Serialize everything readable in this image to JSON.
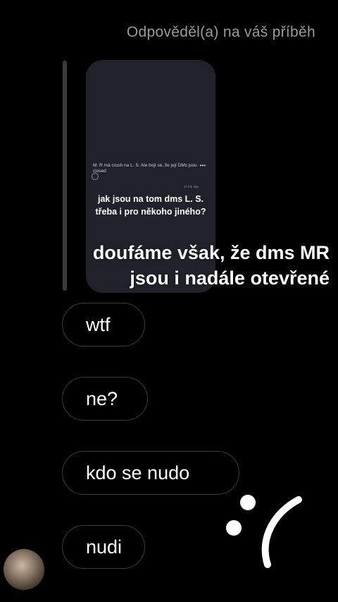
{
  "header": {
    "reply_label": "Odpověděl(a) na váš příběh"
  },
  "story": {
    "tweet_text": "M. R má crush na L. S. Ale bojí se, že její DMs jsou closed",
    "tweet_dots": "•••",
    "tweet_meta": "ch frie nge",
    "overlay_line1": "jak jsou na tom dms L. S.",
    "overlay_line2": "třeba i pro někoho jiného?"
  },
  "caption": {
    "line1": "doufáme však, že dms MR",
    "line2": "jsou i nadále otevřené"
  },
  "messages": [
    {
      "text": "wtf"
    },
    {
      "text": "ne?"
    },
    {
      "text": "kdo se nudo"
    },
    {
      "text": "nudi"
    }
  ],
  "sticker": {
    "icon": "sad-face-icon",
    "color": "#ffffff"
  },
  "colors": {
    "background": "#000000",
    "bubble_border": "#3b3b3b",
    "header_text": "#9a9a9a"
  }
}
